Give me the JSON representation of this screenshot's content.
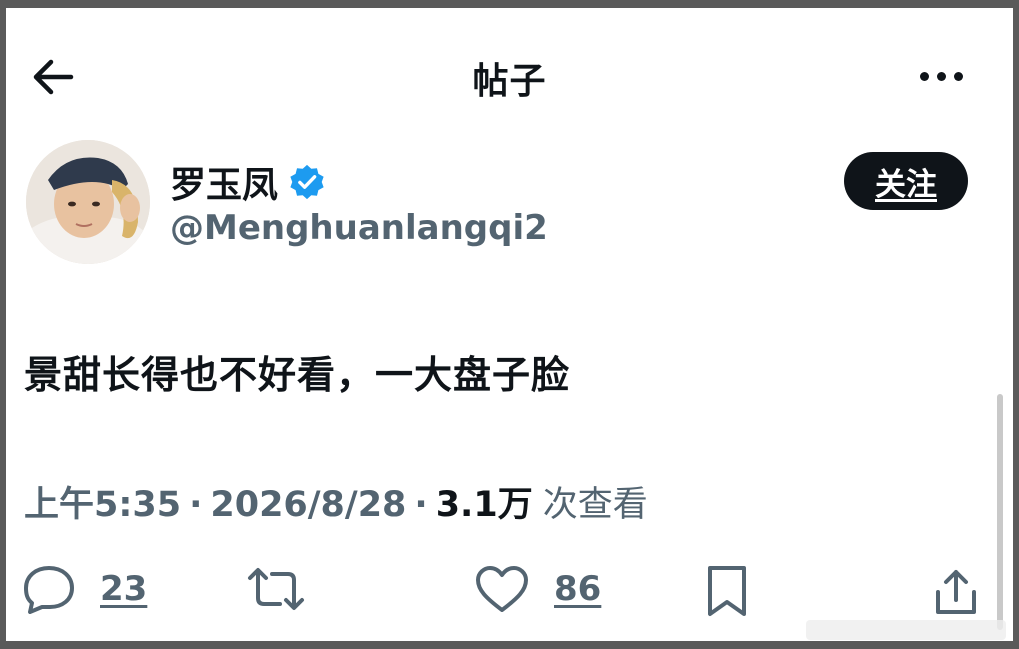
{
  "header": {
    "title": "帖子",
    "back_icon": "arrow-left-icon",
    "more_icon": "more-horizontal-icon"
  },
  "author": {
    "name": "罗玉凤",
    "handle": "@Menghuanlangqi2",
    "verified_color": "#1d9bf0",
    "follow_label": "关注"
  },
  "tweet": {
    "text": "景甜长得也不好看，一大盘子脸"
  },
  "meta": {
    "time": "上午5:35",
    "separator": "·",
    "date": "2026/8/28",
    "views": "3.1万",
    "views_label": "次查看"
  },
  "actions": {
    "reply_count": "23",
    "like_count": "86"
  },
  "colors": {
    "text": "#0f1419",
    "secondary": "#536471",
    "accent": "#1d9bf0"
  }
}
